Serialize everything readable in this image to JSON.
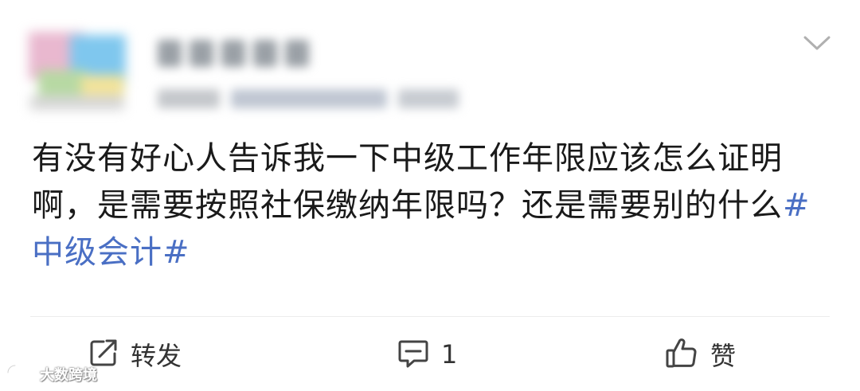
{
  "post": {
    "text_main": "有没有好心人告诉我一下中级工作年限应该怎么证明啊，是需要按照社保缴纳年限吗？还是需要别的什么",
    "hashtag": "#中级会计#"
  },
  "actions": {
    "repost_label": "转发",
    "comment_count": "1",
    "like_label": "赞"
  },
  "watermark": {
    "text": "大数跨境"
  },
  "colors": {
    "hashtag": "#4a6fc4",
    "text": "#1a1a1a",
    "action_icon": "#444444",
    "divider": "#ececec"
  },
  "icons": {
    "repost": "share-arrow-icon",
    "comment": "comment-bubble-icon",
    "like": "thumbs-up-icon",
    "more": "chevron-down-icon"
  }
}
